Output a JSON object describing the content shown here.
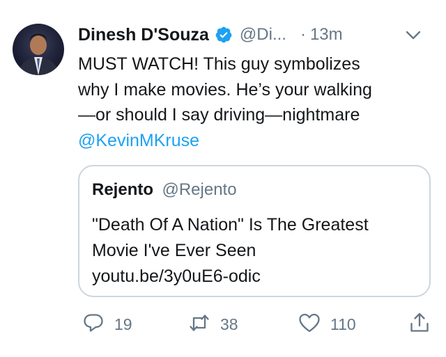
{
  "author": {
    "name": "Dinesh D'Souza",
    "handle": "@Di...",
    "time": "13m",
    "dot": "·",
    "verified": true
  },
  "tweet": {
    "lines": [
      "MUST WATCH! This guy symbolizes",
      "why I make movies. He’s your walking",
      "—or should I say driving—nightmare"
    ],
    "mention": "@KevinMKruse"
  },
  "quoted_tweet": {
    "name": "Rejento",
    "handle": "@Rejento",
    "lines": [
      "\"Death Of A Nation\" Is The Greatest",
      "Movie I've Ever Seen",
      "youtu.be/3y0uE6-odic"
    ]
  },
  "actions": {
    "replies": "19",
    "retweets": "38",
    "likes": "110"
  },
  "icons": {
    "verified": "verified-badge-icon",
    "more": "chevron-down-icon",
    "reply": "reply-icon",
    "retweet": "retweet-icon",
    "like": "heart-icon",
    "share": "share-icon"
  },
  "colors": {
    "accent": "#1da1f2",
    "text": "#14171a",
    "secondary": "#657786",
    "border": "#ccd6dd"
  }
}
